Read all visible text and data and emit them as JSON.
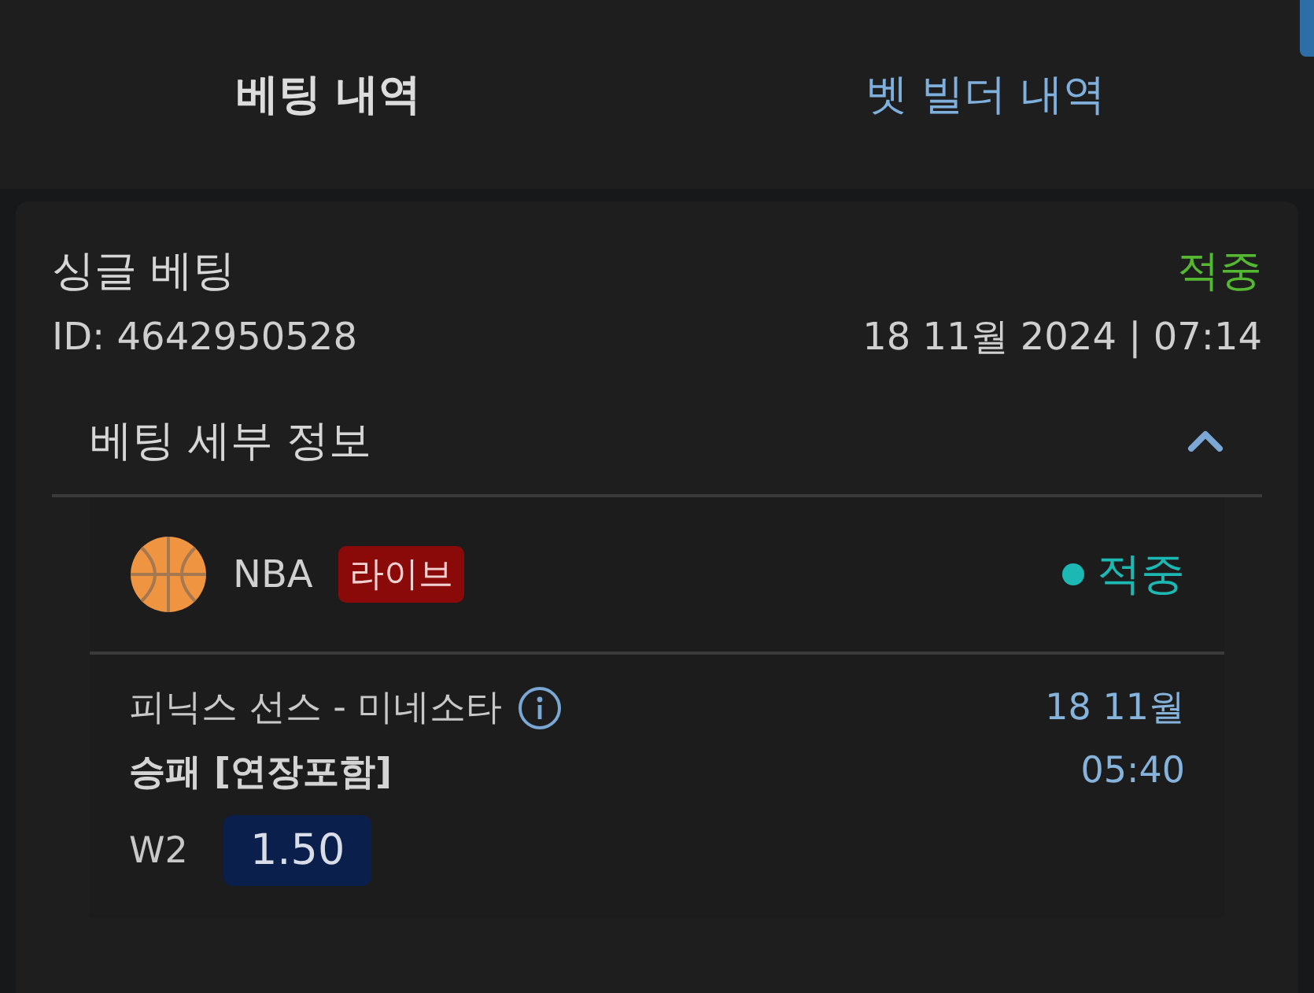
{
  "tabs": [
    {
      "label": "베팅 내역",
      "selected": true
    },
    {
      "label": "벳 빌더 내역",
      "selected": false
    }
  ],
  "bet": {
    "type": "싱글 베팅",
    "status": "적중",
    "id": "ID: 4642950528",
    "datetime": "18 11월 2024 | 07:14",
    "details": {
      "title": "베팅 세부 정보",
      "expanded": true,
      "event": {
        "league": "NBA",
        "badge": "라이브",
        "status": "적중",
        "color": "#1cb8b3",
        "match": "피닉스 선스 - 미네소타",
        "date": "18 11월",
        "time": "05:40",
        "market": "승패 [연장포함]",
        "pick": "W2",
        "odds": "1.50"
      }
    }
  }
}
